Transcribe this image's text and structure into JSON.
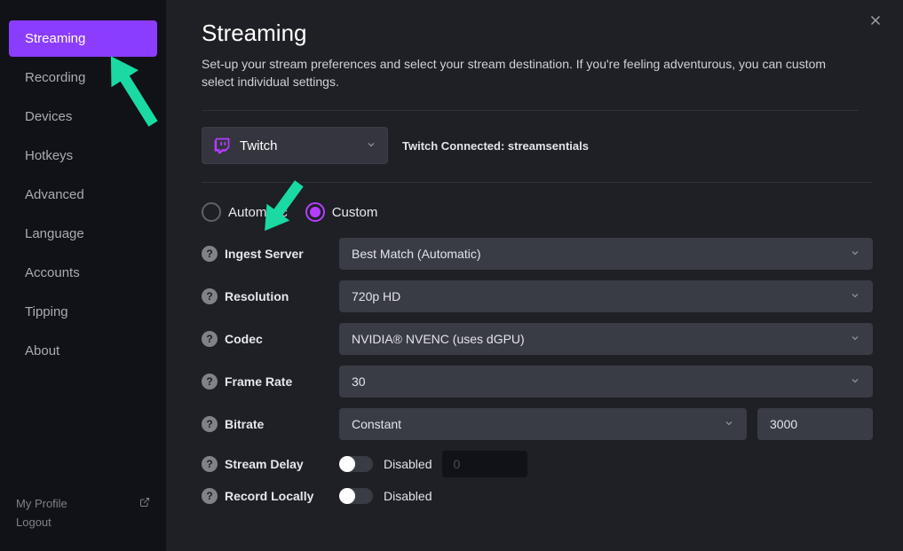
{
  "sidebar": {
    "items": [
      {
        "label": "Streaming"
      },
      {
        "label": "Recording"
      },
      {
        "label": "Devices"
      },
      {
        "label": "Hotkeys"
      },
      {
        "label": "Advanced"
      },
      {
        "label": "Language"
      },
      {
        "label": "Accounts"
      },
      {
        "label": "Tipping"
      },
      {
        "label": "About"
      }
    ],
    "footer": {
      "profile": "My Profile",
      "logout": "Logout"
    }
  },
  "header": {
    "title": "Streaming",
    "subtitle": "Set-up your stream preferences and select your stream destination. If you're feeling adventurous, you can custom select individual settings."
  },
  "destination": {
    "selected": "Twitch",
    "status": "Twitch Connected: streamsentials"
  },
  "mode": {
    "option1": "Automatic",
    "option2": "Custom"
  },
  "settings": {
    "ingest": {
      "label": "Ingest Server",
      "value": "Best Match (Automatic)"
    },
    "resolution": {
      "label": "Resolution",
      "value": "720p HD"
    },
    "codec": {
      "label": "Codec",
      "value": "NVIDIA® NVENC (uses dGPU)"
    },
    "framerate": {
      "label": "Frame Rate",
      "value": "30"
    },
    "bitrate": {
      "label": "Bitrate",
      "mode": "Constant",
      "value": "3000"
    },
    "delay": {
      "label": "Stream Delay",
      "status": "Disabled",
      "value": "0"
    },
    "recordlocal": {
      "label": "Record Locally",
      "status": "Disabled"
    }
  }
}
